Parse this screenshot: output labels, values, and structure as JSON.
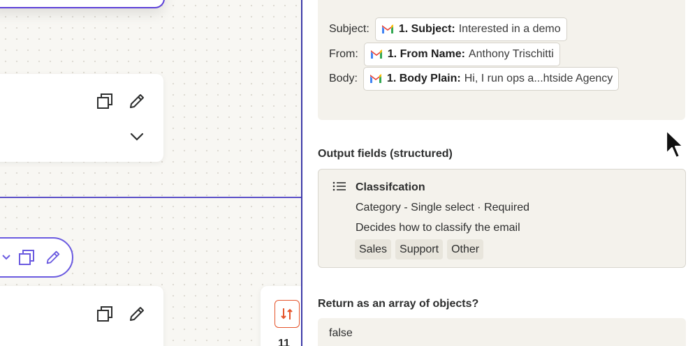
{
  "mapping": {
    "rows": [
      {
        "label": "Subject:",
        "token_key": "1. Subject:",
        "token_value": "Interested in a demo"
      },
      {
        "label": "From:",
        "token_key": "1. From Name:",
        "token_value": "Anthony Trischitti"
      },
      {
        "label": "Body:",
        "token_key": "1. Body Plain:",
        "token_value": "Hi, I run ops a...htside Agency"
      }
    ]
  },
  "output_fields": {
    "title": "Output fields (structured)",
    "field_name": "Classifcation",
    "field_type": "Category - Single select · Required",
    "field_description": "Decides how to classify the email",
    "options": [
      "Sales",
      "Support",
      "Other"
    ]
  },
  "return_array": {
    "title": "Return as an array of objects?",
    "value": "false"
  },
  "canvas": {
    "mini_card_number": "11"
  },
  "icons": {
    "token_app": "gmail-icon",
    "list": "list-icon",
    "duplicate": "duplicate-icon",
    "edit": "pencil-icon",
    "expand": "chevron-down-icon",
    "sort": "sort-arrows-icon",
    "pointer": "mouse-cursor-icon"
  },
  "colors": {
    "selection_border": "#5b3fd9",
    "panel_border": "#3d3aa8",
    "accent_orange": "#e5542b",
    "panel_bg": "#f4f2ec"
  }
}
